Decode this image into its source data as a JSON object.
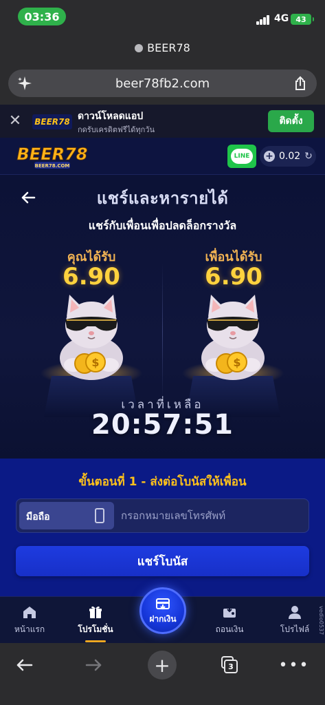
{
  "status_bar": {
    "time": "03:36",
    "network": "4G",
    "battery": "43"
  },
  "browser": {
    "site_name": "BEER78",
    "url": "beer78fb2.com",
    "tabs_count": "3"
  },
  "app_banner": {
    "title": "ดาวน์โหลดแอป",
    "subtitle": "กดรับเครดิตฟรีได้ทุกวัน",
    "install_label": "ติดตั้ง",
    "logo_text": "BEER78"
  },
  "header": {
    "logo_text": "BEER78",
    "logo_sub": "BEER78.COM",
    "line_label": "LINE",
    "balance": "0.02"
  },
  "share": {
    "title": "แชร์และหารายได้",
    "subtitle": "แชร์กับเพื่อนเพื่อปลดล็อกรางวัล",
    "you_receive_label": "คุณได้รับ",
    "you_receive_amount": "6.90",
    "friend_receive_label": "เพื่อนได้รับ",
    "friend_receive_amount": "6.90",
    "time_left_label": "เวลาที่เหลือ",
    "countdown": "20:57:51"
  },
  "step": {
    "title": "ขั้นตอนที่ 1 - ส่งต่อโบนัสให้เพื่อน",
    "phone_tag": "มือถือ",
    "phone_placeholder": "กรอกหมายเลขโทรศัพท์",
    "share_button": "แชร์โบนัส"
  },
  "bottom_nav": {
    "items": [
      {
        "label": "หน้าแรก",
        "icon": "home-icon"
      },
      {
        "label": "โปรโมชั่น",
        "icon": "gift-icon",
        "active": true
      },
      {
        "label": "ฝากเงิน",
        "icon": "deposit-icon"
      },
      {
        "label": "ถอนเงิน",
        "icon": "withdraw-icon"
      },
      {
        "label": "โปรไฟล์",
        "icon": "profile-icon"
      }
    ],
    "side_tag": "vedio0537"
  },
  "colors": {
    "accent_gold": "#ffd23e",
    "step_title": "#ffc21a",
    "primary_blue": "#1e3be0",
    "install_green": "#2aa84a",
    "line_green": "#1fc44a"
  }
}
